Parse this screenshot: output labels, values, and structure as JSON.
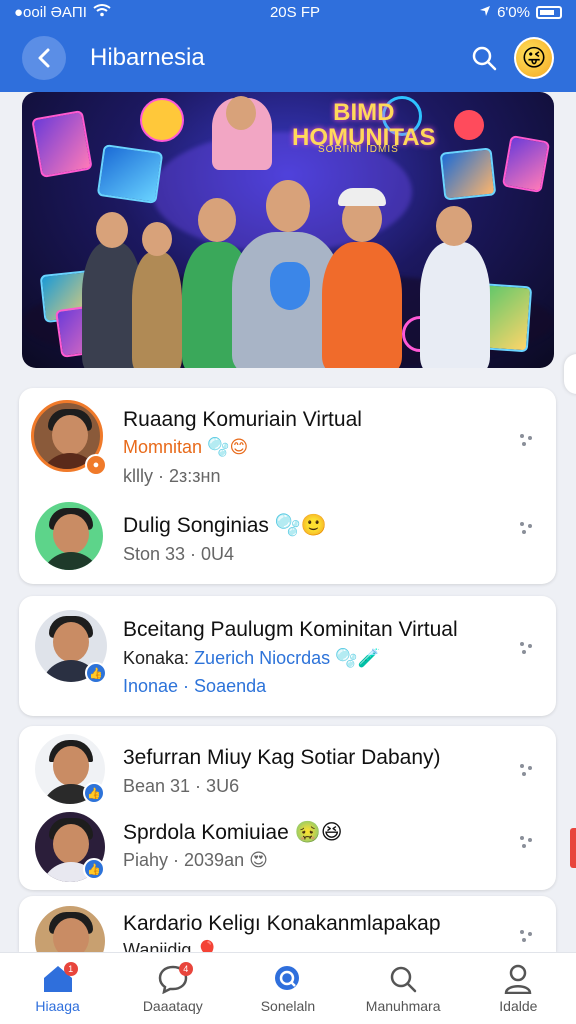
{
  "status_bar": {
    "carrier": "●ooil ƏAΠI",
    "time": "20S FP",
    "battery": "6'0%"
  },
  "header": {
    "title": "Hibarnesia"
  },
  "banner": {
    "title_line1": "BIMD",
    "title_line2": "HOMUNITAS",
    "subtitle": "SORIINI IDMIS"
  },
  "cards": [
    {
      "rows": [
        {
          "name": "Ruaang Komuriain Virtual",
          "line2": "Momnitan 🫧😊",
          "line3": "kllly · 2з:знn"
        },
        {
          "name": "Dulig Songinias 🫧🙂",
          "line2": "Ston 33 · 0U4"
        }
      ]
    },
    {
      "rows": [
        {
          "name": "Bceitang Paulugm Kominitan Virtual",
          "line2_prefix": "Konaka: ",
          "line2_link": "Zuerich Niocrdas",
          "line2_suffix": " 🫧🧪",
          "line3": "Inonae · Soaenda"
        }
      ]
    },
    {
      "rows": [
        {
          "name": "3efurran Miuy Kag Sotiar Dabany)",
          "line2": "Bean 31 · 3U6"
        },
        {
          "name": "Sprdola Komiuiae 🤢😆",
          "line2": "Piahy · 2039an 😍"
        }
      ]
    },
    {
      "rows": [
        {
          "name": "Kardario Keligı Konakanmlapakap",
          "line2": "Wanjidig 🎈"
        }
      ]
    }
  ],
  "tabs": [
    {
      "label": "Hiaaga",
      "icon": "home-icon",
      "badge": "1",
      "active": true
    },
    {
      "label": "Daaataqy",
      "icon": "chat-icon",
      "badge": "4",
      "active": false
    },
    {
      "label": "Sonelaln",
      "icon": "search-icon",
      "active": false
    },
    {
      "label": "Manuhmara",
      "icon": "search-icon",
      "active": false
    },
    {
      "label": "Idalde",
      "icon": "profile-icon",
      "active": false
    }
  ],
  "colors": {
    "primary": "#2f6fdc",
    "background": "#eef0f5",
    "badge_red": "#e8453c",
    "link_blue": "#2d73d9",
    "accent_orange": "#e86a1a"
  }
}
